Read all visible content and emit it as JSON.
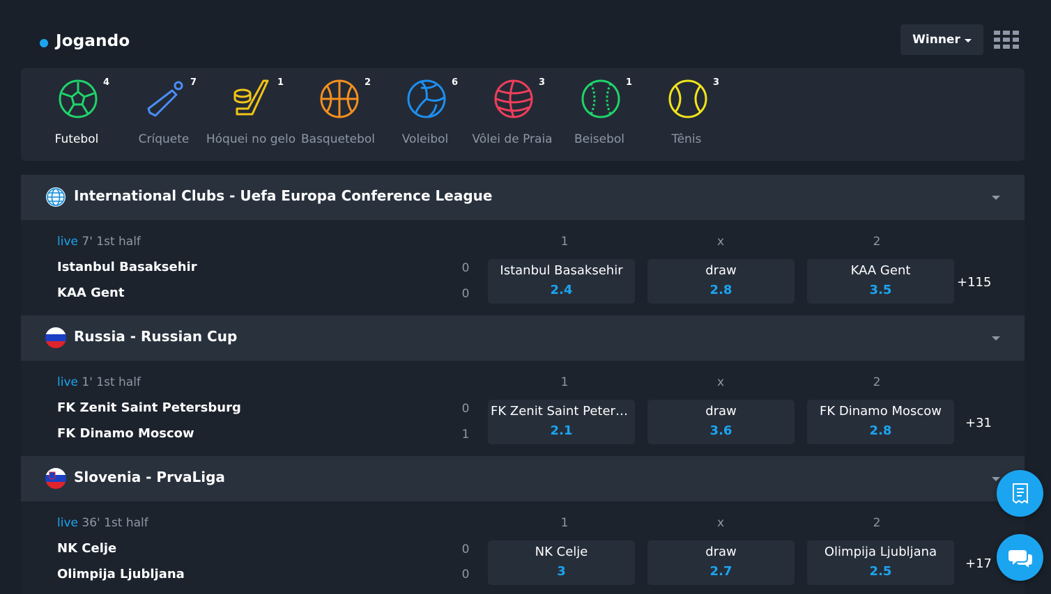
{
  "header": {
    "title": "Jogando",
    "market_selector": "Winner"
  },
  "colors": {
    "background": "#1a2029",
    "accent": "#1ba5f0",
    "football": "#1fd46b",
    "cricket": "#4a8df8",
    "hockey": "#f2c318",
    "basketball": "#f5901f",
    "volleyball": "#1e8ff0",
    "beach_volleyball": "#f03e5c",
    "baseball": "#1fd46b",
    "tennis": "#f2e41b"
  },
  "sports": [
    {
      "label": "Futebol",
      "count": "4",
      "icon": "soccer-ball-icon",
      "active": true
    },
    {
      "label": "Críquete",
      "count": "7",
      "icon": "cricket-bat-icon",
      "active": false
    },
    {
      "label": "Hóquei no gelo",
      "count": "1",
      "icon": "hockey-stick-icon",
      "active": false
    },
    {
      "label": "Basquetebol",
      "count": "2",
      "icon": "basketball-icon",
      "active": false
    },
    {
      "label": "Voleibol",
      "count": "6",
      "icon": "volleyball-icon",
      "active": false
    },
    {
      "label": "Vôlei de Praia",
      "count": "3",
      "icon": "beach-volleyball-icon",
      "active": false
    },
    {
      "label": "Beisebol",
      "count": "1",
      "icon": "baseball-icon",
      "active": false
    },
    {
      "label": "Tênis",
      "count": "3",
      "icon": "tennis-ball-icon",
      "active": false
    }
  ],
  "leagues": [
    {
      "name": "International Clubs - Uefa Europa Conference League",
      "flag": "globe-icon",
      "match": {
        "live_label": "live",
        "status": "7' 1st half",
        "home": "Istanbul Basaksehir",
        "away": "KAA Gent",
        "home_score": "0",
        "away_score": "0",
        "col_home": "1",
        "col_draw": "x",
        "col_away": "2",
        "odds": [
          {
            "label": "Istanbul Basaksehir",
            "value": "2.4"
          },
          {
            "label": "draw",
            "value": "2.8"
          },
          {
            "label": "KAA Gent",
            "value": "3.5"
          }
        ],
        "more": "+115"
      }
    },
    {
      "name": "Russia - Russian Cup",
      "flag": "russia-flag-icon",
      "match": {
        "live_label": "live",
        "status": "1' 1st half",
        "home": "FK Zenit Saint Petersburg",
        "away": "FK Dinamo Moscow",
        "home_score": "0",
        "away_score": "1",
        "col_home": "1",
        "col_draw": "x",
        "col_away": "2",
        "odds": [
          {
            "label": "FK Zenit Saint Petersburg",
            "value": "2.1"
          },
          {
            "label": "draw",
            "value": "3.6"
          },
          {
            "label": "FK Dinamo Moscow",
            "value": "2.8"
          }
        ],
        "more": "+31"
      }
    },
    {
      "name": "Slovenia - PrvaLiga",
      "flag": "slovenia-flag-icon",
      "match": {
        "live_label": "live",
        "status": "36' 1st half",
        "home": "NK Celje",
        "away": "Olimpija Ljubljana",
        "home_score": "0",
        "away_score": "0",
        "col_home": "1",
        "col_draw": "x",
        "col_away": "2",
        "odds": [
          {
            "label": "NK Celje",
            "value": "3"
          },
          {
            "label": "draw",
            "value": "2.7"
          },
          {
            "label": "Olimpija Ljubljana",
            "value": "2.5"
          }
        ],
        "more": "+17"
      }
    }
  ]
}
